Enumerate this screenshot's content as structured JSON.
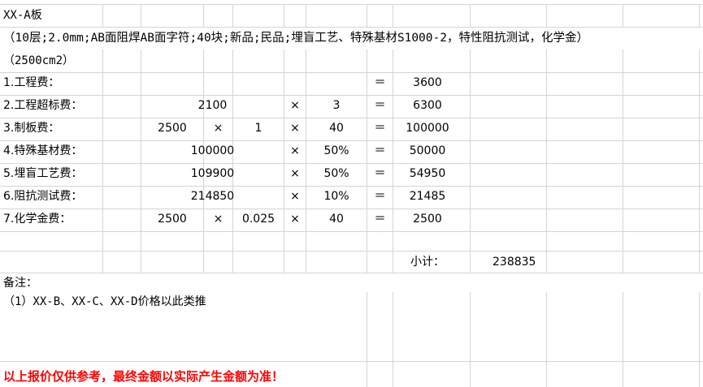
{
  "sheet": {
    "title": "XX-A板",
    "spec": "（10层;2.0mm;AB面阻焊AB面字符;40块;新品;民品;埋盲工艺、特殊基材S1000-2，特性阻抗测试，化学金）",
    "area": "（2500cm2）"
  },
  "ops": {
    "times": "×",
    "equals": "＝"
  },
  "rows": [
    {
      "label": "1.工程费：",
      "result": "3600"
    },
    {
      "label": "2.工程超标费：",
      "base": "2100",
      "factor": "3",
      "result": "6300"
    },
    {
      "label": "3.制板费：",
      "a": "2500",
      "b": "1",
      "factor": "40",
      "result": "100000"
    },
    {
      "label": "4.特殊基材费：",
      "base": "100000",
      "factor": "50%",
      "result": "50000"
    },
    {
      "label": "5.埋盲工艺费：",
      "base": "109900",
      "factor": "50%",
      "result": "54950"
    },
    {
      "label": "6.阻抗测试费：",
      "base": "214850",
      "factor": "10%",
      "result": "21485"
    },
    {
      "label": "7.化学金费：",
      "a": "2500",
      "b": "0.025",
      "factor": "40",
      "result": "2500"
    }
  ],
  "subtotal": {
    "label": "小计：",
    "value": "238835"
  },
  "notes": {
    "heading": "备注：",
    "item1": "（1）XX-B、XX-C、XX-D价格以此类推"
  },
  "disclaimer": "以上报价仅供参考，最终金额以实际产生金额为准！",
  "colors": {
    "grid": "#d4d4d4",
    "warning": "#ff0000"
  }
}
